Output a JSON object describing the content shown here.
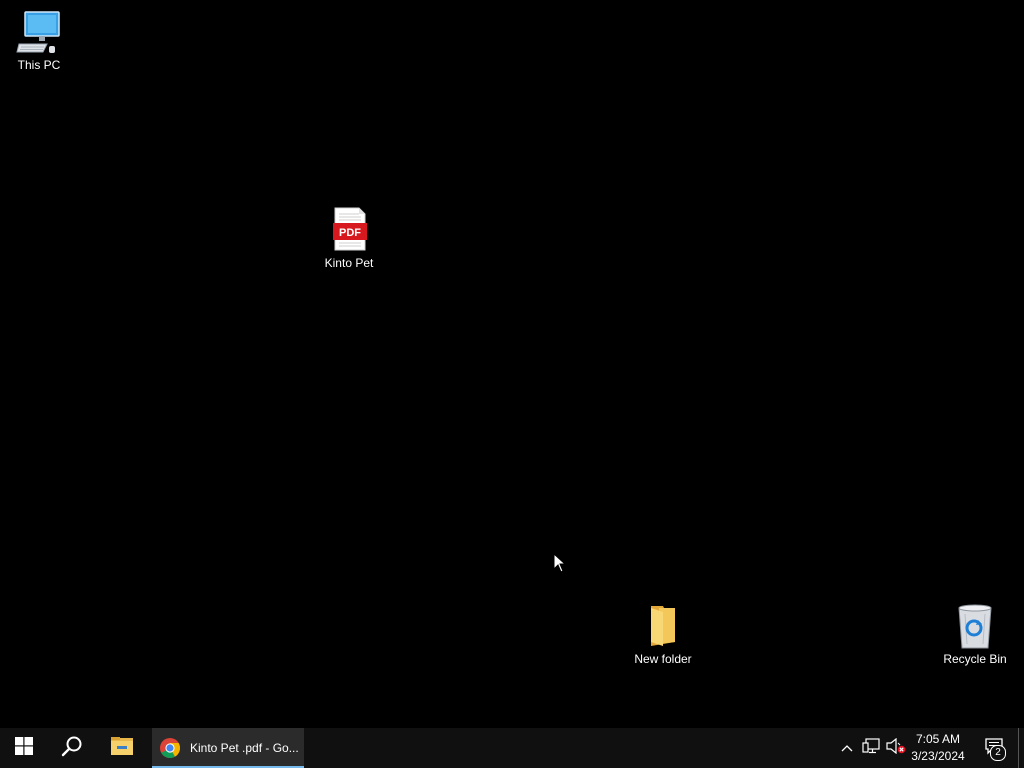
{
  "desktop": {
    "icons": [
      {
        "label": "This PC",
        "icon": "computer-icon"
      },
      {
        "label": "Kinto Pet",
        "icon": "pdf-file-icon",
        "badge_text": "PDF"
      },
      {
        "label": "New folder",
        "icon": "folder-icon"
      },
      {
        "label": "Recycle Bin",
        "icon": "recycle-bin-icon"
      }
    ]
  },
  "taskbar": {
    "start_icon": "windows-logo-icon",
    "search_icon": "search-icon",
    "explorer_icon": "file-explorer-icon",
    "active_task": {
      "label": "Kinto Pet .pdf - Go...",
      "icon": "chrome-icon"
    },
    "tray": {
      "chevron_icon": "chevron-up-icon",
      "network_icon": "network-icon",
      "volume_icon": "volume-muted-icon"
    },
    "clock": {
      "time": "7:05 AM",
      "date": "3/23/2024"
    },
    "notifications": {
      "icon": "action-center-icon",
      "count": "2"
    }
  },
  "colors": {
    "desktop_bg": "#000000",
    "taskbar_bg": "#101010",
    "active_task_underline": "#76b9ed",
    "pdf_red": "#d7191f",
    "folder_yellow": "#f3c75a"
  }
}
